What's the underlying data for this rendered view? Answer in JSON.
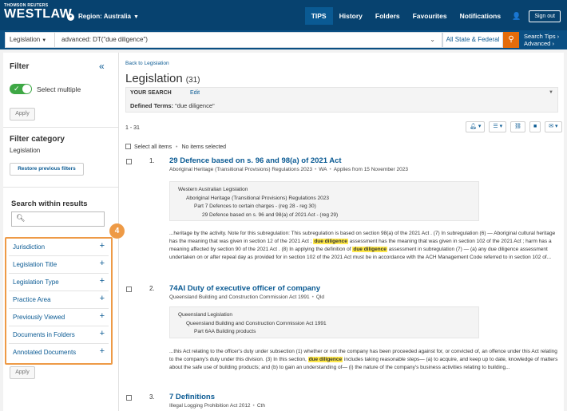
{
  "header": {
    "brand_small": "THOMSON REUTERS",
    "brand": "WESTLAW",
    "region": "Region: Australia",
    "nav": [
      "TIPS",
      "History",
      "Folders",
      "Favourites",
      "Notifications"
    ],
    "sign_out": "Sign out"
  },
  "search": {
    "scope": "Legislation",
    "query": "advanced: DT(\"due diligence\")",
    "jurisdiction": "All State & Federal",
    "tips_line1": "Search Tips ›",
    "tips_line2": "Advanced ›"
  },
  "sidebar": {
    "filter_title": "Filter",
    "collapse": "«",
    "select_multiple": "Select multiple",
    "apply": "Apply",
    "filter_category_title": "Filter category",
    "filter_category_value": "Legislation",
    "restore": "Restore previous filters",
    "search_within_title": "Search within results",
    "badge": "4",
    "facets": [
      {
        "label": "Jurisdiction"
      },
      {
        "label": "Legislation Title"
      },
      {
        "label": "Legislation Type"
      },
      {
        "label": "Practice Area"
      },
      {
        "label": "Previously Viewed"
      },
      {
        "label": "Documents in Folders"
      },
      {
        "label": "Annotated Documents"
      }
    ],
    "apply_bottom": "Apply"
  },
  "content": {
    "back": "Back to Legislation",
    "title": "Legislation",
    "count": "(31)",
    "your_search_label": "YOUR SEARCH",
    "edit": "Edit",
    "defined_terms_label": "Defined Terms:",
    "defined_terms_value": "\"due diligence\"",
    "range": "1 - 31",
    "select_all": "Select all items",
    "no_selected": "No items selected",
    "results": [
      {
        "num": "1.",
        "title": "29 Defence based on s. 96 and 98(a) of 2021 Act",
        "meta_title": "Aboriginal Heritage (Transitional Provisions) Regulations 2023",
        "jurisdiction": "WA",
        "applies": "Applies from 15 November 2023",
        "hierarchy": [
          "Western Australian Legislation",
          "Aboriginal Heritage (Transitional Provisions) Regulations 2023",
          "Part 7 Defences to certain charges - (reg 28 - reg 30)",
          "29 Defence based on s. 96 and 98(a) of 2021 Act - (reg 29)"
        ],
        "snippet_parts": [
          "...heritage by the activity. Note for this subregulation: This subregulation is based on section 98(a) of the 2021 Act . (7) In subregulation (6) — Aboriginal cultural heritage has the meaning that was given in section 12 of the 2021 Act ; ",
          "due diligence",
          " assessment has the meaning that was given in section 102 of the 2021 Act ; harm has a meaning affected by section 90 of the 2021 Act . (8) In applying the definition of ",
          "due diligence",
          " assessment in subregulation (7) — (a) any due diligence assessment undertaken on or after repeal day as provided for in section 102 of the 2021 Act must be in accordance with the ACH Management Code referred to in section 102 of..."
        ]
      },
      {
        "num": "2.",
        "title": "74AI Duty of executive officer of company",
        "meta_title": "Queensland Building and Construction Commission Act 1991",
        "jurisdiction": "Qld",
        "hierarchy": [
          "Queensland Legislation",
          "Queensland Building and Construction Commission Act 1991",
          "Part 6AA Building products"
        ],
        "snippet_parts": [
          "...this Act relating to the officer's duty under subsection (1) whether or not the company has been proceeded against for, or convicted of, an offence under this Act relating to the company's duty under this division. (3) In this section, ",
          "due diligence",
          " includes taking reasonable steps— (a) to acquire, and keep up to date, knowledge of matters about the safe use of building products; and (b) to gain an understanding of— (i) the nature of the company's business activities relating to building..."
        ]
      },
      {
        "num": "3.",
        "title": "7 Definitions",
        "meta_title": "Illegal Logging Prohibition Act 2012",
        "jurisdiction": "Cth"
      }
    ]
  }
}
